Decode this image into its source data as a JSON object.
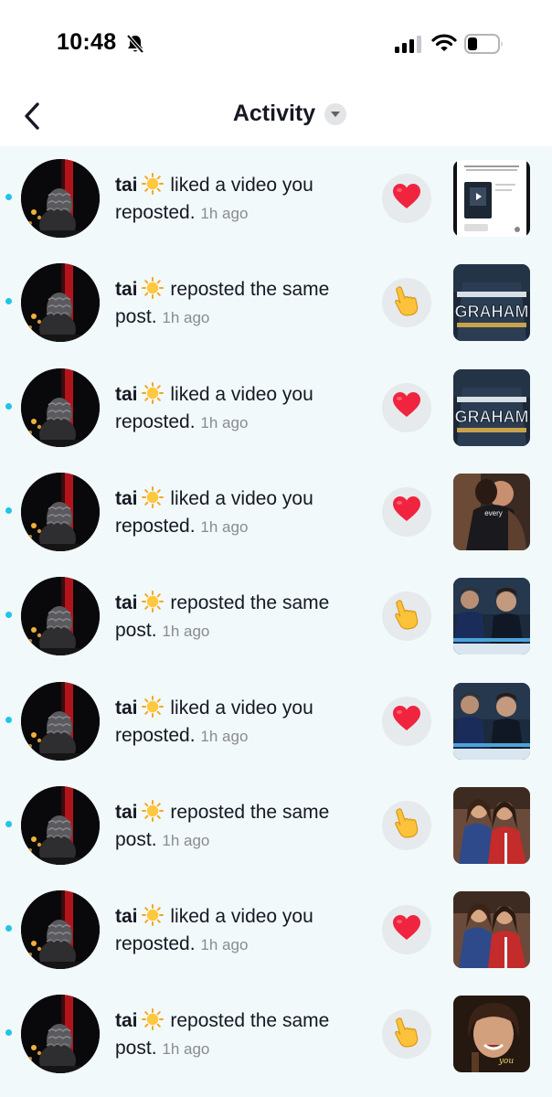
{
  "status_bar": {
    "time": "10:48",
    "icons": [
      "bell-off-icon",
      "signal-icon",
      "wifi-icon",
      "battery-icon"
    ]
  },
  "header": {
    "back_icon": "chevron-left-icon",
    "title": "Activity",
    "dropdown_icon": "caret-down-icon"
  },
  "colors": {
    "unread_dot": "#20c4e8",
    "list_background": "#f1f9fb",
    "like_heart": "#fe2c55",
    "timestamp": "#8a8b91"
  },
  "activities": [
    {
      "user": "tai",
      "emoji": "sun-icon",
      "action": "liked a video you reposted.",
      "time": "1h ago",
      "type": "like",
      "action_icon": "heart-icon",
      "thumb": "screenshot"
    },
    {
      "user": "tai",
      "emoji": "sun-icon",
      "action": "reposted the same post.",
      "time": "1h ago",
      "type": "repost",
      "action_icon": "pointing-hand-icon",
      "thumb": "jersey",
      "thumb_text": "GRAHAM"
    },
    {
      "user": "tai",
      "emoji": "sun-icon",
      "action": "liked a video you reposted.",
      "time": "1h ago",
      "type": "like",
      "action_icon": "heart-icon",
      "thumb": "jersey",
      "thumb_text": "GRAHAM"
    },
    {
      "user": "tai",
      "emoji": "sun-icon",
      "action": "liked a video you reposted.",
      "time": "1h ago",
      "type": "like",
      "action_icon": "heart-icon",
      "thumb": "hug",
      "thumb_text": "every"
    },
    {
      "user": "tai",
      "emoji": "sun-icon",
      "action": "reposted the same post.",
      "time": "1h ago",
      "type": "repost",
      "action_icon": "pointing-hand-icon",
      "thumb": "rink"
    },
    {
      "user": "tai",
      "emoji": "sun-icon",
      "action": "liked a video you reposted.",
      "time": "1h ago",
      "type": "like",
      "action_icon": "heart-icon",
      "thumb": "rink"
    },
    {
      "user": "tai",
      "emoji": "sun-icon",
      "action": "reposted the same post.",
      "time": "1h ago",
      "type": "repost",
      "action_icon": "pointing-hand-icon",
      "thumb": "girls"
    },
    {
      "user": "tai",
      "emoji": "sun-icon",
      "action": "liked a video you reposted.",
      "time": "1h ago",
      "type": "like",
      "action_icon": "heart-icon",
      "thumb": "girls"
    },
    {
      "user": "tai",
      "emoji": "sun-icon",
      "action": "reposted the same post.",
      "time": "1h ago",
      "type": "repost",
      "action_icon": "pointing-hand-icon",
      "thumb": "smile",
      "thumb_text": "you"
    }
  ]
}
